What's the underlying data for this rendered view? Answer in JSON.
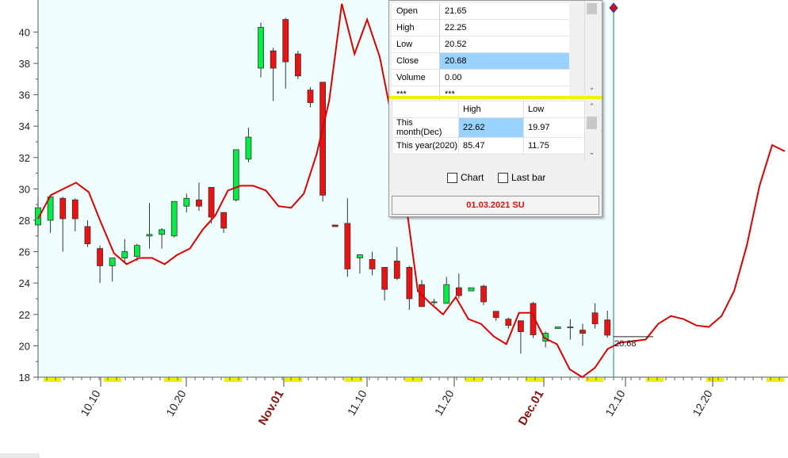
{
  "chart_data": {
    "type": "candlestick",
    "y_ticks": [
      "18",
      "20",
      "22",
      "24",
      "26",
      "28",
      "30",
      "32",
      "34",
      "36",
      "38",
      "40"
    ],
    "ylim": [
      18,
      41.8
    ],
    "x_labels": [
      {
        "label": "10.10",
        "month": false
      },
      {
        "label": "10.20",
        "month": false
      },
      {
        "label": "Nov.01",
        "month": true
      },
      {
        "label": "11.10",
        "month": false
      },
      {
        "label": "11.20",
        "month": false
      },
      {
        "label": "Dec.01",
        "month": true
      },
      {
        "label": "12.10",
        "month": false
      },
      {
        "label": "12.20",
        "month": false
      }
    ],
    "candles": [
      [
        27.7,
        29.5,
        27.0,
        28.8
      ],
      [
        28.0,
        29.6,
        27.2,
        29.5
      ],
      [
        29.4,
        29.5,
        26.0,
        28.1
      ],
      [
        29.3,
        29.4,
        27.3,
        28.1
      ],
      [
        27.6,
        28.0,
        26.3,
        26.5
      ],
      [
        26.2,
        26.4,
        24.0,
        25.1
      ],
      [
        25.1,
        25.6,
        24.1,
        25.6
      ],
      [
        25.6,
        26.8,
        25.3,
        26.0
      ],
      [
        25.7,
        26.5,
        25.4,
        26.4
      ],
      [
        27.0,
        29.1,
        26.2,
        27.1
      ],
      [
        27.1,
        27.5,
        26.2,
        27.4
      ],
      [
        27.0,
        29.2,
        26.9,
        29.2
      ],
      [
        28.9,
        29.7,
        28.5,
        29.4
      ],
      [
        29.3,
        30.4,
        28.6,
        28.9
      ],
      [
        30.1,
        30.1,
        27.8,
        28.2
      ],
      [
        28.5,
        28.5,
        27.2,
        27.5
      ],
      [
        29.3,
        32.5,
        29.2,
        32.5
      ],
      [
        31.9,
        33.9,
        31.7,
        33.3
      ],
      [
        37.7,
        40.6,
        37.1,
        40.3
      ],
      [
        38.8,
        39.0,
        35.6,
        37.7
      ],
      [
        40.8,
        40.9,
        36.4,
        38.1
      ],
      [
        38.6,
        38.8,
        37.0,
        37.2
      ],
      [
        36.3,
        36.5,
        35.2,
        35.5
      ],
      [
        36.8,
        36.8,
        29.2,
        29.6
      ],
      [
        27.7,
        27.7,
        27.6,
        27.6
      ],
      [
        27.8,
        29.4,
        24.4,
        24.9
      ],
      [
        25.6,
        25.8,
        24.6,
        25.8
      ],
      [
        25.5,
        26.0,
        24.5,
        24.9
      ],
      [
        25.0,
        25.0,
        22.9,
        23.6
      ],
      [
        25.4,
        26.3,
        24.2,
        24.3
      ],
      [
        25.0,
        25.1,
        22.3,
        23.0
      ],
      [
        23.9,
        24.2,
        22.6,
        22.5
      ],
      [
        22.8,
        23.0,
        22.6,
        22.8
      ],
      [
        22.7,
        24.4,
        22.7,
        23.9
      ],
      [
        23.7,
        24.6,
        23.0,
        23.2
      ],
      [
        23.5,
        23.7,
        23.5,
        23.7
      ],
      [
        23.8,
        23.9,
        22.6,
        22.8
      ],
      [
        22.2,
        22.2,
        21.6,
        21.8
      ],
      [
        21.7,
        21.8,
        21.1,
        21.3
      ],
      [
        21.6,
        21.6,
        19.5,
        20.9
      ],
      [
        22.7,
        22.8,
        20.5,
        20.7
      ],
      [
        20.3,
        20.9,
        19.9,
        20.8
      ],
      [
        21.1,
        21.2,
        21.1,
        21.2
      ],
      [
        21.2,
        21.7,
        20.4,
        21.2
      ],
      [
        21.0,
        21.4,
        20.0,
        20.8
      ],
      [
        22.1,
        22.7,
        21.1,
        21.4
      ],
      [
        21.65,
        22.25,
        20.52,
        20.68
      ]
    ],
    "indicator_line": [
      28.1,
      29.6,
      30.0,
      30.4,
      29.8,
      27.8,
      25.9,
      25.2,
      25.6,
      25.6,
      25.2,
      25.8,
      26.2,
      27.4,
      28.3,
      29.9,
      30.2,
      30.2,
      29.9,
      28.9,
      28.8,
      29.7,
      32.2,
      35.6,
      41.8,
      38.6,
      40.8,
      38.4,
      34.3,
      29.5,
      23.5,
      22.7,
      22.0,
      23.1,
      21.7,
      21.4,
      20.6,
      20.1,
      22.1,
      22.1,
      20.5,
      20.1,
      18.5,
      18.0,
      18.6,
      19.8,
      20.2,
      20.3,
      20.4,
      21.4,
      21.9,
      21.7,
      21.3,
      21.2,
      21.9,
      23.5,
      26.4,
      30.2,
      32.8,
      32.4
    ],
    "last_value_label": "20.68",
    "last_value": 20.68
  },
  "info_panel": {
    "ohlc_rows": [
      {
        "label": "Open",
        "value": "21.65"
      },
      {
        "label": "High",
        "value": "22.25"
      },
      {
        "label": "Low",
        "value": "20.52"
      },
      {
        "label": "Close",
        "value": "20.68"
      },
      {
        "label": "Volume",
        "value": "0.00"
      },
      {
        "label": "***",
        "value": "***"
      }
    ],
    "hl_header": {
      "col1": "",
      "col2": "High",
      "col3": "Low"
    },
    "hl_rows": [
      {
        "label": "This month(Dec)",
        "high": "22.62",
        "low": "19.97"
      },
      {
        "label": "This year(2020)",
        "high": "85.47",
        "low": "11.75"
      }
    ],
    "chart_checkbox_label": "Chart",
    "last_bar_checkbox_label": "Last bar",
    "date_text": "01.03.2021 SU"
  },
  "colors": {
    "plot_bg": "#f0fdfd",
    "up_candle": "#00ee44",
    "down_candle": "#ee1111",
    "indicator": "#dd0000",
    "cursor_line": "#1a8080",
    "month_label": "#8b1010",
    "date_text": "#e01010"
  }
}
